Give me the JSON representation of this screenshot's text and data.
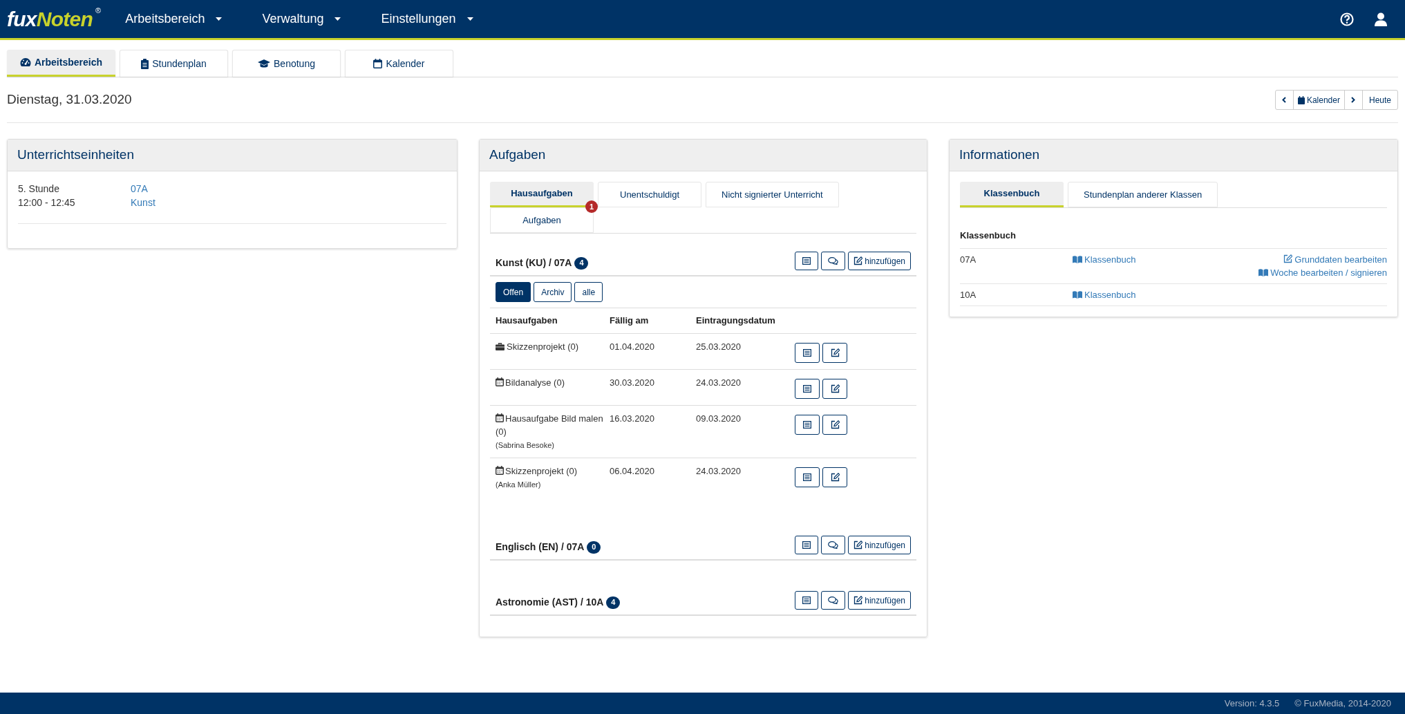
{
  "header": {
    "logo_left": "fux",
    "logo_right": "Noten",
    "logo_mark": "®",
    "menus": [
      {
        "label": "Arbeitsbereich"
      },
      {
        "label": "Verwaltung"
      },
      {
        "label": "Einstellungen"
      }
    ]
  },
  "tabs": [
    {
      "label": "Arbeitsbereich",
      "selected": true,
      "kind": "gauge"
    },
    {
      "label": "Stundenplan",
      "selected": false,
      "kind": "clipboard"
    },
    {
      "label": "Benotung",
      "selected": false,
      "kind": "cap"
    },
    {
      "label": "Kalender",
      "selected": false,
      "kind": "calendar"
    }
  ],
  "date": "Dienstag, 31.03.2020",
  "date_nav": {
    "calendar": "Kalender",
    "today": "Heute"
  },
  "lessons_panel": {
    "title": "Unterrichtseinheiten",
    "lessons": [
      {
        "period": "5. Stunde",
        "time": "12:00 - 12:45",
        "class": "07A",
        "subject": "Kunst"
      }
    ]
  },
  "tasks_panel": {
    "title": "Aufgaben",
    "tabs": [
      {
        "label": "Hausaufgaben",
        "selected": true
      },
      {
        "label": "Unentschuldigt",
        "selected": false
      },
      {
        "label": "Nicht signierter Unterricht",
        "selected": false
      },
      {
        "label": "Aufgaben",
        "selected": false,
        "badge": "1"
      }
    ],
    "courses": [
      {
        "title": "Kunst (KU) / 07A",
        "count": "4",
        "add_label": "hinzufügen",
        "filters": [
          {
            "label": "Offen",
            "selected": true
          },
          {
            "label": "Archiv",
            "selected": false
          },
          {
            "label": "alle",
            "selected": false
          }
        ],
        "columns": [
          "Hausaufgaben",
          "Fällig am",
          "Eintragungsdatum"
        ],
        "rows": [
          {
            "kind": "briefcase",
            "name": "Skizzenprojekt (0)",
            "due": "01.04.2020",
            "entered": "25.03.2020"
          },
          {
            "kind": "calendar",
            "name": "Bildanalyse (0)",
            "due": "30.03.2020",
            "entered": "24.03.2020"
          },
          {
            "kind": "calendar",
            "name": "Hausaufgabe Bild malen (0)",
            "author": "(Sabrina Besoke)",
            "due": "16.03.2020",
            "entered": "09.03.2020"
          },
          {
            "kind": "calendar",
            "name": "Skizzenprojekt (0)",
            "author": "(Anka Müller)",
            "due": "06.04.2020",
            "entered": "24.03.2020"
          }
        ]
      },
      {
        "title": "Englisch (EN) / 07A",
        "count": "0",
        "add_label": "hinzufügen"
      },
      {
        "title": "Astronomie (AST) / 10A",
        "count": "4",
        "add_label": "hinzufügen"
      }
    ]
  },
  "info_panel": {
    "title": "Informationen",
    "tabs": [
      {
        "label": "Klassenbuch",
        "selected": true
      },
      {
        "label": "Stundenplan anderer Klassen",
        "selected": false
      }
    ],
    "heading": "Klassenbuch",
    "rows": [
      {
        "class": "07A",
        "link": "Klassenbuch",
        "actions": [
          "Grunddaten bearbeiten",
          "Woche bearbeiten / signieren"
        ]
      },
      {
        "class": "10A",
        "link": "Klassenbuch"
      }
    ]
  },
  "footer": {
    "version": "Version: 4.3.5",
    "copyright": "© FuxMedia, 2014-2020"
  }
}
